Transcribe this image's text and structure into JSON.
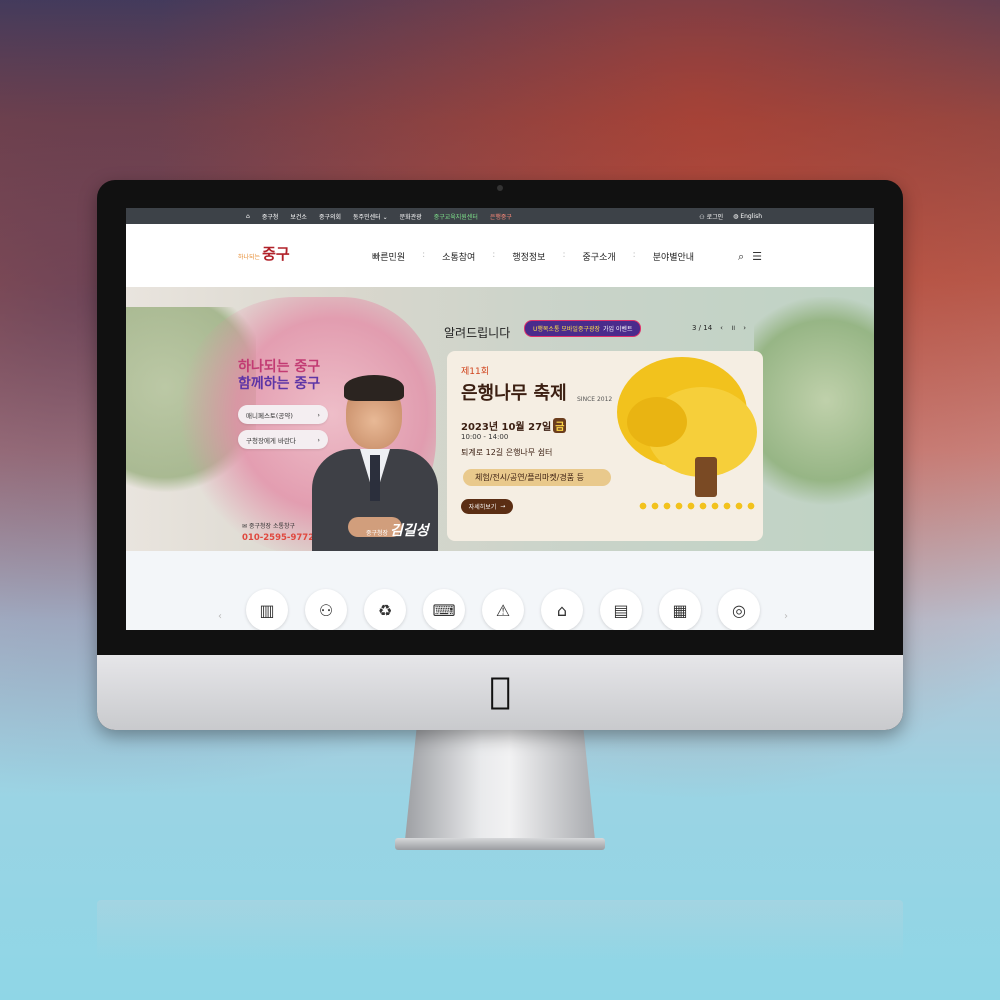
{
  "topbar": {
    "links": [
      "중구청",
      "보건소",
      "중구의회",
      "동주민센터",
      "문화관광",
      "중구교육지원센터",
      "은행중구"
    ],
    "login": "로그인",
    "english": "English"
  },
  "header": {
    "logo_sub": "하나되는",
    "logo_main": "중구",
    "gnb": [
      "빠른민원",
      "소통참여",
      "행정정보",
      "중구소개",
      "분야별안내"
    ]
  },
  "hero": {
    "slogan_line1": "하나되는 중구",
    "slogan_line2": "함께하는 중구",
    "btn_manifesto": "매니페스토(공약)",
    "btn_to_mayor": "구청장에게 바란다",
    "hotline_label": "중구청장 소통창구",
    "hotline_phone": "010-2595-9772",
    "mayor_title": "중구청장",
    "mayor_sign": "김길성",
    "notice_title": "알려드립니다",
    "notice_badge_highlight": "U행복소통 모바일중구광장",
    "notice_badge_text": "가입 이벤트",
    "pager_text": "3 / 14",
    "card": {
      "edition": "제11회",
      "name": "은행나무 축제",
      "since": "SINCE 2012",
      "date": "2023년 10월 27일",
      "day": "금",
      "time": "10:00 - 14:00",
      "place": "퇴계로 12길 은행나무 쉼터",
      "program": "체험/전시/공연/플리마켓/경품 등",
      "more": "자세히보기"
    }
  },
  "quick_icons": [
    "building-icon",
    "people-search-icon",
    "recycle-bin-icon",
    "desk-worker-icon",
    "car-warning-icon",
    "house-icon",
    "document-card-icon",
    "calculator-icon",
    "certificate-icon"
  ],
  "colors": {
    "topbar_bg": "#3d4248",
    "slogan_pink": "#c23b73",
    "slogan_purple": "#5d35a6",
    "phone_red": "#e0483f",
    "festival_brown": "#3b1f12",
    "ginkgo_yellow": "#f2c21d"
  }
}
